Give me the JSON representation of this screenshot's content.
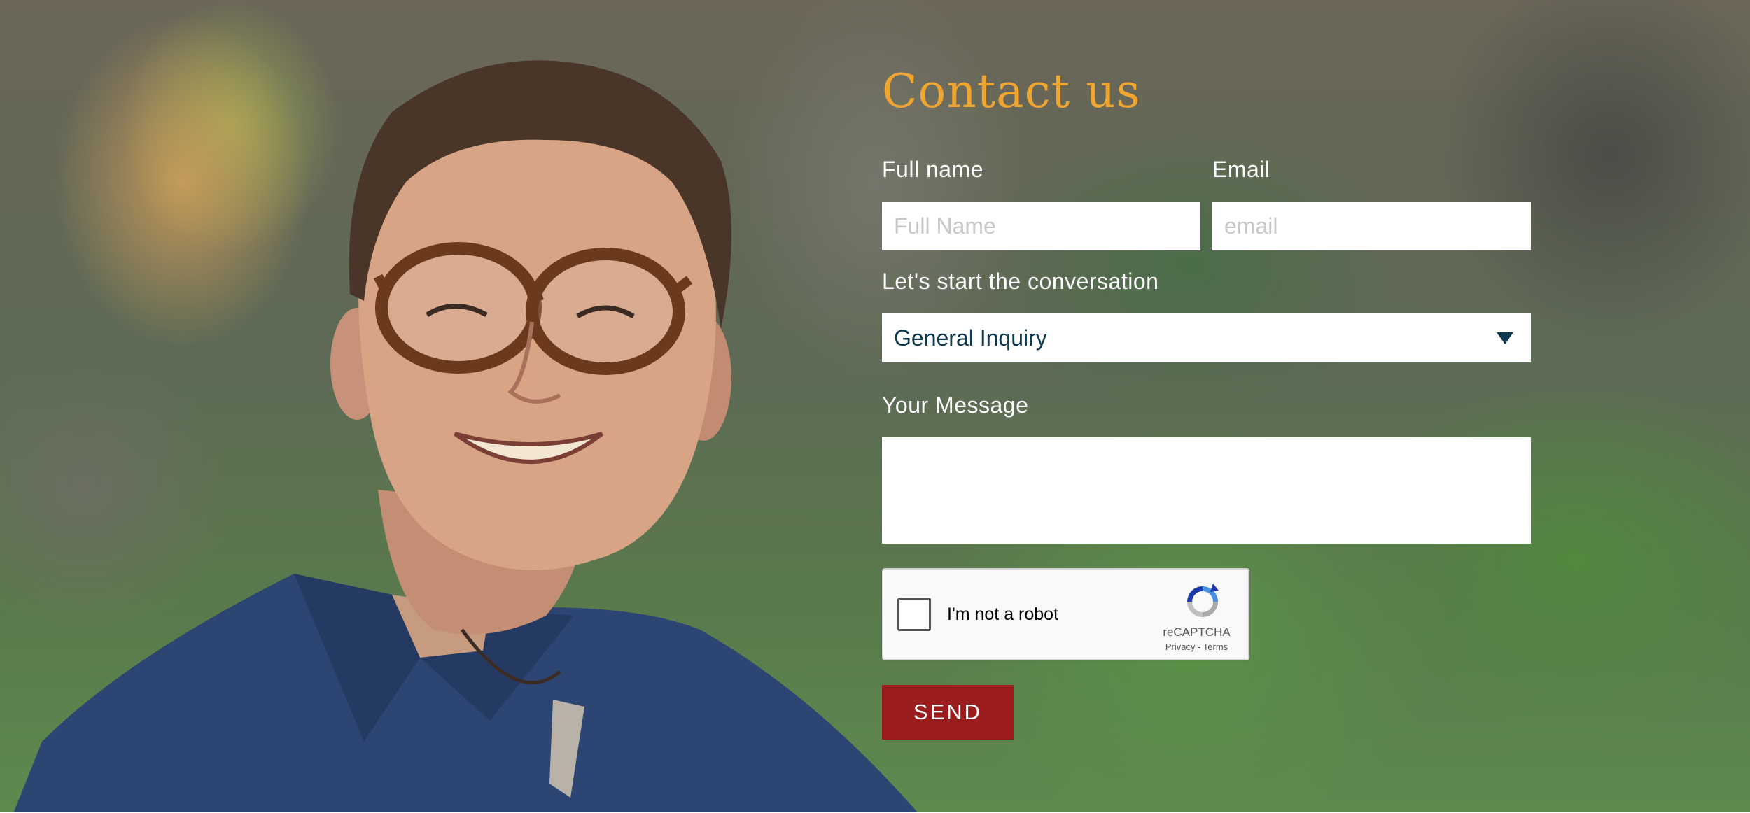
{
  "photo": {
    "alt": "Smiling man with glasses in blue shirt"
  },
  "form": {
    "title": "Contact us",
    "full_name": {
      "label": "Full name",
      "placeholder": "Full Name",
      "value": ""
    },
    "email": {
      "label": "Email",
      "placeholder": "email",
      "value": ""
    },
    "topic": {
      "label": "Let's start the conversation",
      "selected": "General Inquiry"
    },
    "message": {
      "label": "Your Message",
      "value": ""
    },
    "captcha": {
      "label": "I'm not a robot",
      "brand": "reCAPTCHA",
      "privacy": "Privacy",
      "separator": " - ",
      "terms": "Terms"
    },
    "submit_label": "SEND"
  },
  "colors": {
    "title": "#f0a531",
    "submit": "#9b1c1c",
    "select_text": "#103a4f"
  }
}
